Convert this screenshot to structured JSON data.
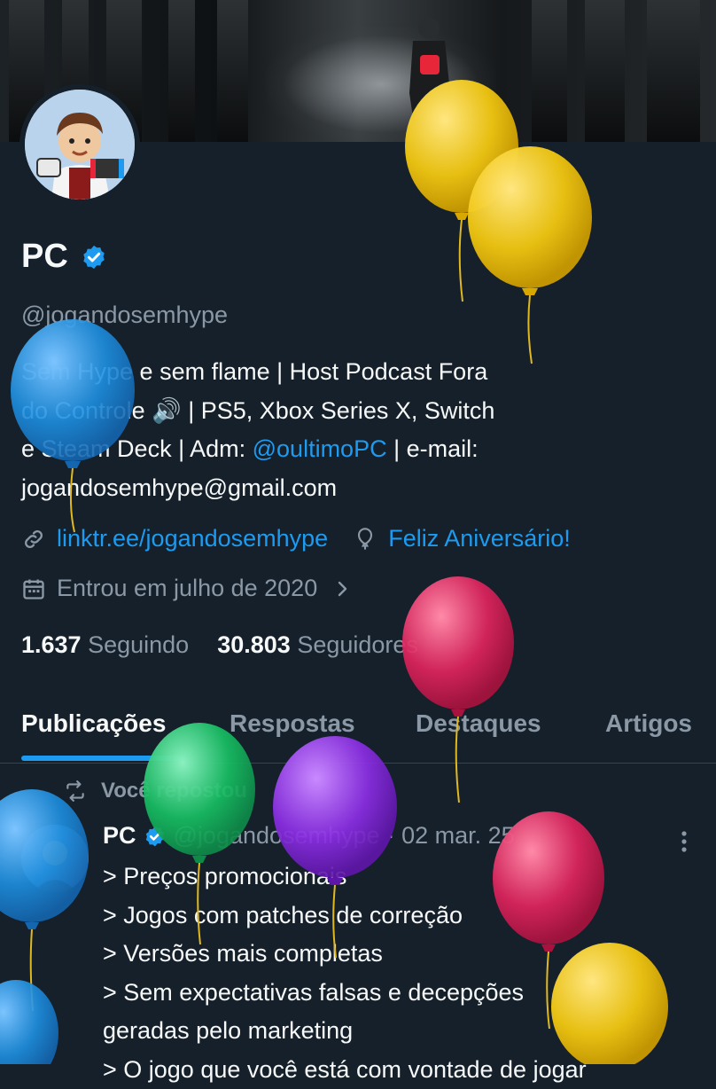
{
  "profile": {
    "name": "PC",
    "handle": "@jogandosemhype",
    "bio": {
      "line1": "Sem Hype e sem flame | Host Podcast Fora",
      "line2": "do Controle 🔊 | PS5, Xbox Series X, Switch",
      "line3_pre": "e  Steam Deck | Adm: ",
      "line3_link": "@oultimoPC",
      "line3_post": " | e-mail:",
      "line4": "jogandosemhype@gmail.com"
    },
    "website": "linktr.ee/jogandosemhype",
    "birthday": "Feliz Aniversário!",
    "joined": "Entrou em julho de 2020",
    "following_count": "1.637",
    "following_label": "Seguindo",
    "followers_count": "30.803",
    "followers_label": "Seguidores"
  },
  "tabs": [
    "Publicações",
    "Respostas",
    "Destaques",
    "Artigos"
  ],
  "post": {
    "repost_label": "Você repostou",
    "author": "PC",
    "author_handle": "@jogandosemhype",
    "date": "· 02 mar. 25",
    "lines": [
      "> Preços promocionais",
      "> Jogos com patches de correção",
      "> Versões mais completas",
      "> Sem expectativas falsas e decepções",
      "geradas pelo marketing",
      "> O jogo que você está com vontade de jogar"
    ]
  },
  "colors": {
    "background": "#15202b",
    "accent": "#1d9bf0",
    "muted": "#8b98a5",
    "balloon_yellow": "#f2c811",
    "balloon_blue": "#1d8fe0",
    "balloon_red": "#e0245e",
    "balloon_green": "#17bf63",
    "balloon_purple": "#8c2ee6"
  }
}
